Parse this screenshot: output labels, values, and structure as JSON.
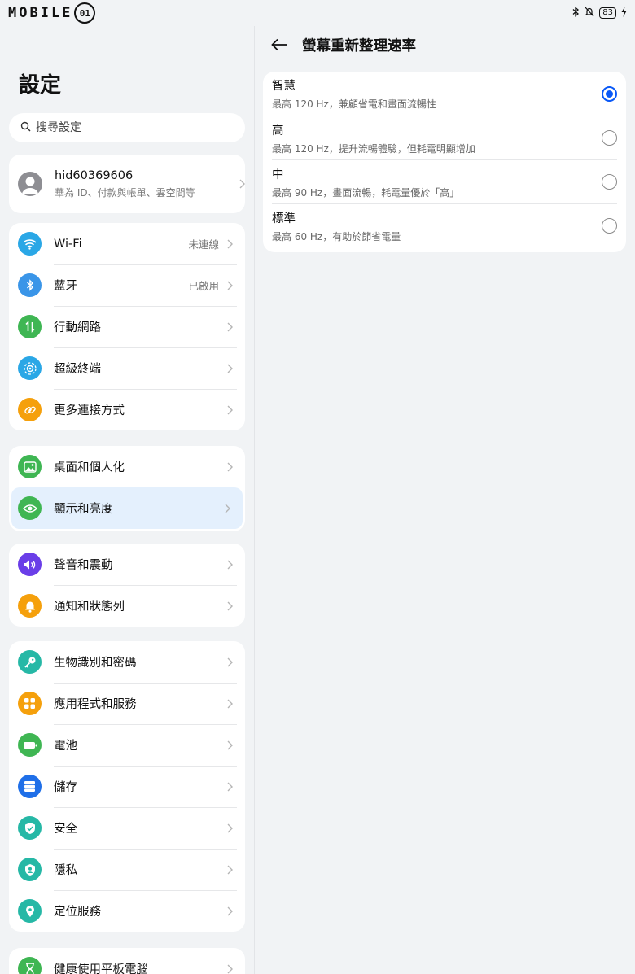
{
  "status_bar": {
    "logo_text": "MOBILE",
    "logo_badge": "01",
    "icons": [
      "bluetooth-icon",
      "mute-bell-icon",
      "charging-icon"
    ],
    "battery": "83"
  },
  "left": {
    "title": "設定",
    "search": {
      "placeholder": "搜尋設定"
    },
    "account": {
      "name": "hid60369606",
      "subtitle": "華為 ID、付款與帳單、雲空間等"
    },
    "group1": [
      {
        "label": "Wi-Fi",
        "value": "未連線",
        "icon": "wifi-icon",
        "color": "#2aa7e6"
      },
      {
        "label": "藍牙",
        "value": "已啟用",
        "icon": "bluetooth-icon",
        "color": "#3a95e8"
      },
      {
        "label": "行動網路",
        "value": "",
        "icon": "mobile-data-icon",
        "color": "#3fb653"
      },
      {
        "label": "超級終端",
        "value": "",
        "icon": "super-device-icon",
        "color": "#2aa7e6"
      },
      {
        "label": "更多連接方式",
        "value": "",
        "icon": "link-icon",
        "color": "#f5a00c"
      }
    ],
    "group2": [
      {
        "label": "桌面和個人化",
        "icon": "wallpaper-icon",
        "color": "#3fb653"
      },
      {
        "label": "顯示和亮度",
        "icon": "eye-icon",
        "color": "#3fb653"
      }
    ],
    "group3": [
      {
        "label": "聲音和震動",
        "icon": "sound-icon",
        "color": "#6a3ee8"
      },
      {
        "label": "通知和狀態列",
        "icon": "bell-icon",
        "color": "#f5a00c"
      }
    ],
    "group4": [
      {
        "label": "生物識別和密碼",
        "icon": "key-icon",
        "color": "#26b8a6"
      },
      {
        "label": "應用程式和服務",
        "icon": "apps-icon",
        "color": "#f5a00c"
      },
      {
        "label": "電池",
        "icon": "battery-icon",
        "color": "#3fb653"
      },
      {
        "label": "儲存",
        "icon": "storage-icon",
        "color": "#1f6fe8"
      },
      {
        "label": "安全",
        "icon": "shield-icon",
        "color": "#26b8a6"
      },
      {
        "label": "隱私",
        "icon": "privacy-icon",
        "color": "#26b8a6"
      },
      {
        "label": "定位服務",
        "icon": "location-icon",
        "color": "#26b8a6"
      }
    ],
    "group5": [
      {
        "label": "健康使用平板電腦",
        "icon": "hourglass-icon",
        "color": "#3fb653"
      }
    ]
  },
  "right": {
    "title": "螢幕重新整理速率",
    "options": [
      {
        "title": "智慧",
        "desc": "最高 120 Hz，兼顧省電和畫面流暢性",
        "selected": true
      },
      {
        "title": "高",
        "desc": "最高 120 Hz，提升流暢體驗，但耗電明顯增加",
        "selected": false
      },
      {
        "title": "中",
        "desc": "最高 90 Hz，畫面流暢，耗電量優於「高」",
        "selected": false
      },
      {
        "title": "標準",
        "desc": "最高 60 Hz，有助於節省電量",
        "selected": false
      }
    ]
  },
  "colors": {
    "accent": "#0a59f7",
    "active_row": "#e4f0fd",
    "background": "#f1f3f5"
  }
}
